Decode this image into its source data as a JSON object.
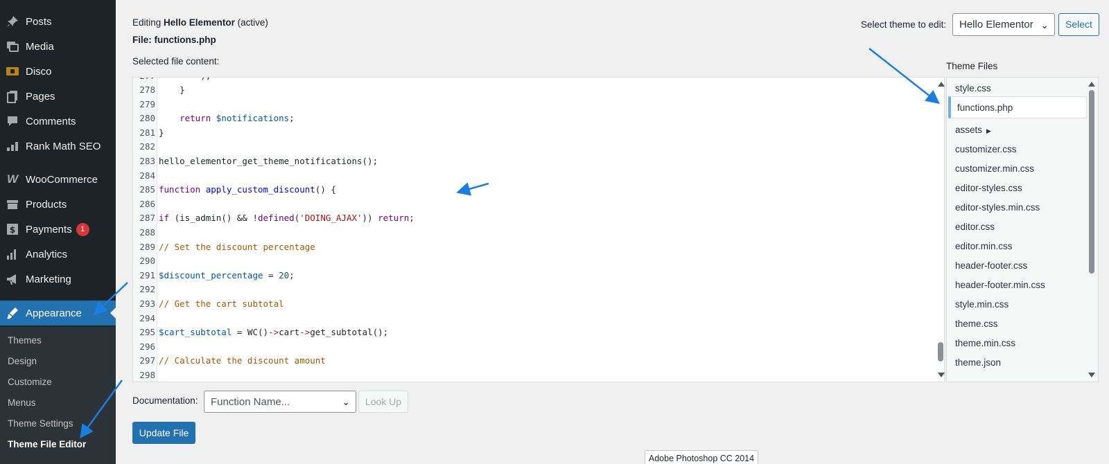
{
  "sidebar": {
    "items": [
      {
        "label": "Posts",
        "icon": "pin-icon"
      },
      {
        "label": "Media",
        "icon": "media-icon"
      },
      {
        "label": "Disco",
        "icon": "disco-icon"
      },
      {
        "label": "Pages",
        "icon": "pages-icon"
      },
      {
        "label": "Comments",
        "icon": "comments-icon"
      },
      {
        "label": "Rank Math SEO",
        "icon": "chart-icon"
      },
      {
        "label": "WooCommerce",
        "icon": "woocommerce-icon"
      },
      {
        "label": "Products",
        "icon": "products-icon"
      },
      {
        "label": "Payments",
        "icon": "payments-icon",
        "badge": "1"
      },
      {
        "label": "Analytics",
        "icon": "analytics-icon"
      },
      {
        "label": "Marketing",
        "icon": "megaphone-icon"
      },
      {
        "label": "Appearance",
        "icon": "brush-icon",
        "active": true
      }
    ],
    "submenu": [
      "Themes",
      "Design",
      "Customize",
      "Menus",
      "Theme Settings",
      "Theme File Editor"
    ]
  },
  "header": {
    "editing_prefix": "Editing",
    "theme_name": "Hello Elementor",
    "active_suffix": "(active)",
    "file_label": "File: functions.php",
    "selected_content_label": "Selected file content:",
    "select_theme_label": "Select theme to edit:",
    "select_theme_value": "Hello Elementor",
    "select_button": "Select"
  },
  "editor": {
    "lines": [
      {
        "n": "278",
        "html": "    }"
      },
      {
        "n": "279",
        "html": ""
      },
      {
        "n": "280",
        "html": "    <span class=\"kw\">return</span> <span class=\"var\">$notifications</span>;"
      },
      {
        "n": "281",
        "html": "}"
      },
      {
        "n": "282",
        "html": ""
      },
      {
        "n": "283",
        "html": "hello_elementor_get_theme_notifications();"
      },
      {
        "n": "284",
        "html": ""
      },
      {
        "n": "285",
        "html": "<span class=\"kw\">function</span> <span class=\"fn\">apply_custom_discount</span>() {"
      },
      {
        "n": "286",
        "html": ""
      },
      {
        "n": "287",
        "html": "<span class=\"kw\">if</span> (is_admin() &amp;&amp; !<span class=\"kw\">defined</span>(<span class=\"str\">'DOING_AJAX'</span>)) <span class=\"kw\">return</span>;"
      },
      {
        "n": "288",
        "html": ""
      },
      {
        "n": "289",
        "html": "<span class=\"cmt\">// Set the discount percentage</span>"
      },
      {
        "n": "290",
        "html": ""
      },
      {
        "n": "291",
        "html": "<span class=\"var\">$discount_percentage</span> = <span class=\"num\">20</span>;"
      },
      {
        "n": "292",
        "html": ""
      },
      {
        "n": "293",
        "html": "<span class=\"cmt\">// Get the cart subtotal</span>"
      },
      {
        "n": "294",
        "html": ""
      },
      {
        "n": "295",
        "html": "<span class=\"var\">$cart_subtotal</span> = WC()<span class=\"op\">-&gt;</span>cart<span class=\"op\">-&gt;</span>get_subtotal();"
      },
      {
        "n": "296",
        "html": ""
      },
      {
        "n": "297",
        "html": "<span class=\"cmt\">// Calculate the discount amount</span>"
      },
      {
        "n": "298",
        "html": ""
      }
    ]
  },
  "theme_files": {
    "title": "Theme Files",
    "files": [
      "style.css",
      "functions.php",
      "assets",
      "customizer.css",
      "customizer.min.css",
      "editor-styles.css",
      "editor-styles.min.css",
      "editor.css",
      "editor.min.css",
      "header-footer.css",
      "header-footer.min.css",
      "style.min.css",
      "theme.css",
      "theme.min.css",
      "theme.json"
    ],
    "current": "functions.php"
  },
  "footer": {
    "documentation_label": "Documentation:",
    "doc_placeholder": "Function Name...",
    "lookup_button": "Look Up",
    "update_button": "Update File",
    "tooltip": "Adobe Photoshop CC 2014"
  },
  "colors": {
    "accent": "#2271b1",
    "sidebar_bg": "#1d2327",
    "annotation_arrow": "#1a7ee0"
  }
}
